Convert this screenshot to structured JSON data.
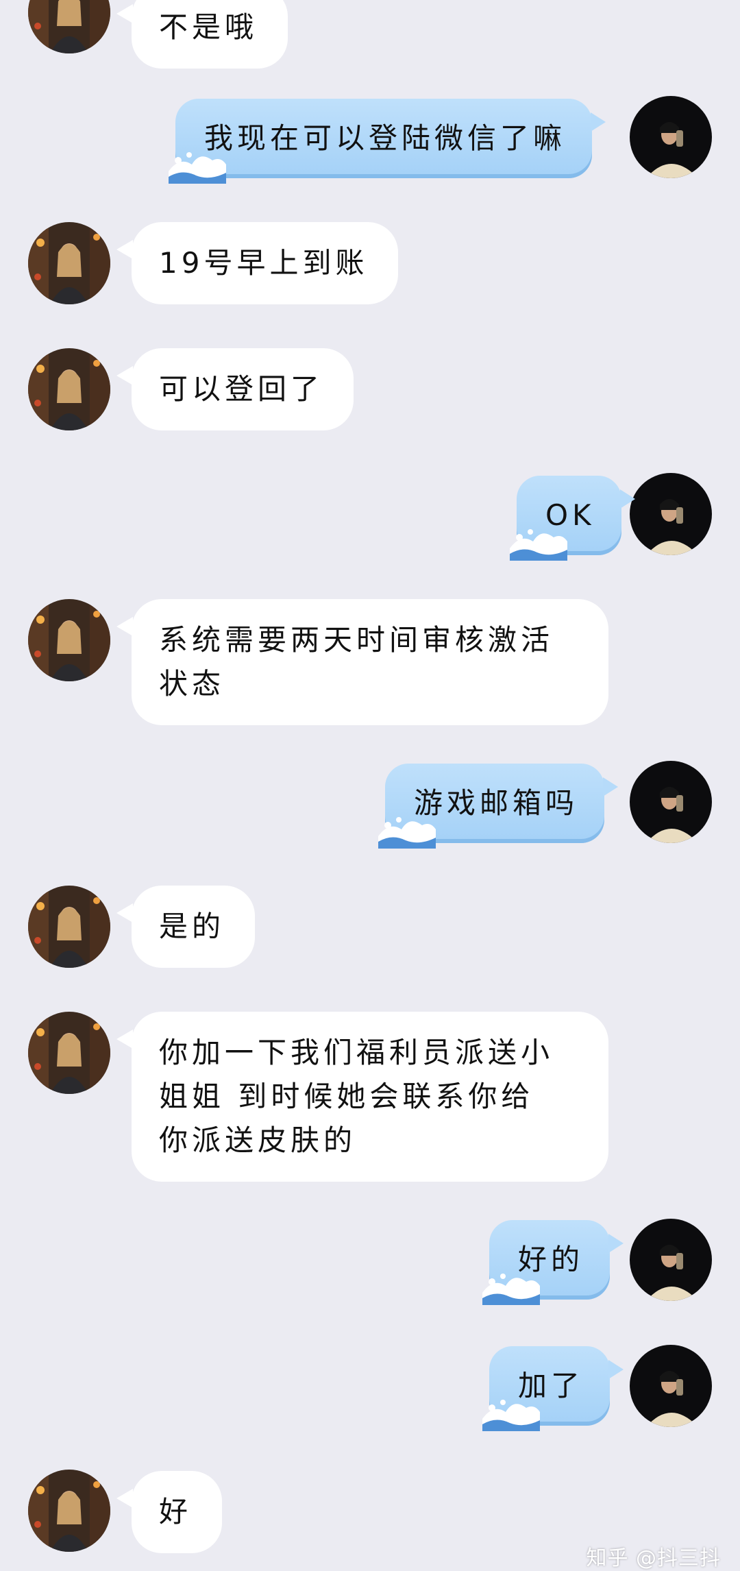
{
  "messages": [
    {
      "from": "friend",
      "text": "不是哦"
    },
    {
      "from": "me",
      "text": "我现在可以登陆微信了嘛"
    },
    {
      "from": "friend",
      "text": "19号早上到账"
    },
    {
      "from": "friend",
      "text": "可以登回了"
    },
    {
      "from": "me",
      "text": "OK"
    },
    {
      "from": "friend",
      "lines": [
        "系统需要两天时间审核激活",
        "状态"
      ]
    },
    {
      "from": "me",
      "text": "游戏邮箱吗"
    },
    {
      "from": "friend",
      "text": "是的"
    },
    {
      "from": "friend",
      "lines": [
        "你加一下我们福利员派送小",
        "姐姐 到时候她会联系你给",
        "你派送皮肤的"
      ]
    },
    {
      "from": "me",
      "text": "好的"
    },
    {
      "from": "me",
      "text": "加了"
    },
    {
      "from": "friend",
      "text": "好"
    }
  ],
  "watermark": "知乎 @抖三抖",
  "colors": {
    "background": "#ebebf2",
    "friend_bubble": "#ffffff",
    "my_bubble": "#b6dbfa"
  },
  "icons": {
    "friend_avatar": "friend-avatar-photo",
    "my_avatar": "my-avatar-photo",
    "bubble_decoration": "wave-icon"
  }
}
